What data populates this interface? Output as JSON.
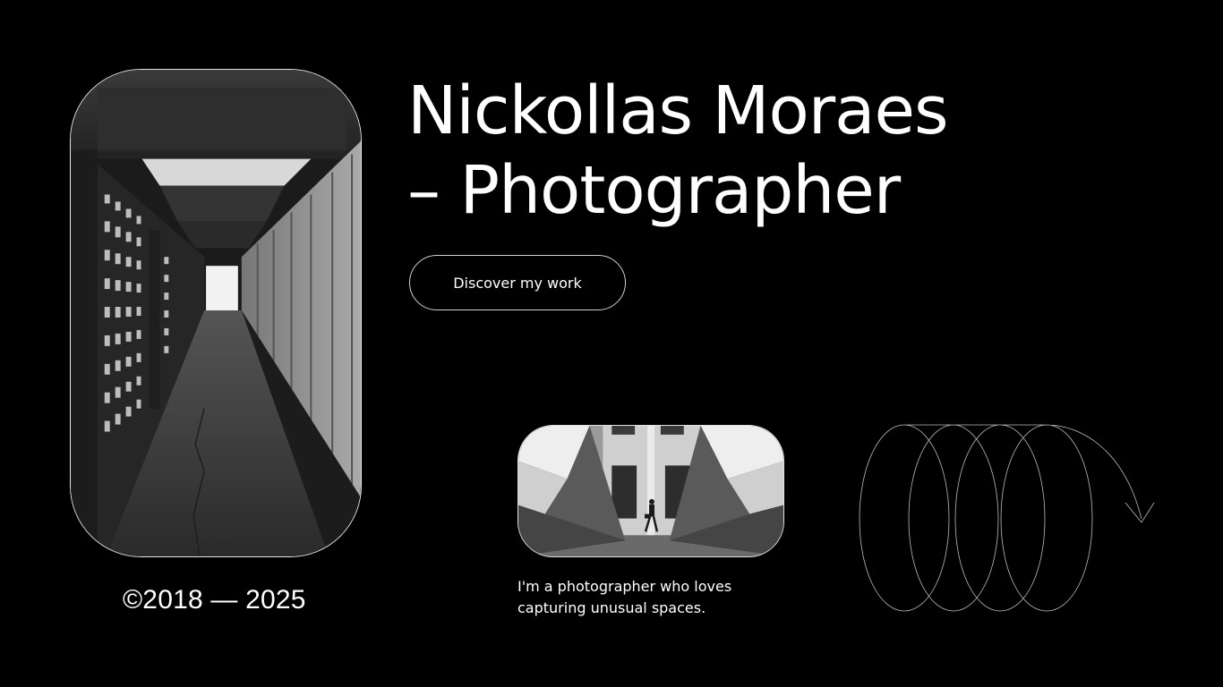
{
  "hero": {
    "title_line1": "Nickollas Moraes",
    "title_line2": "– Photographer",
    "cta_label": "Discover my work"
  },
  "footer": {
    "copyright": "©2018 — 2025"
  },
  "about": {
    "bio": "I'm a photographer who loves capturing unusual spaces."
  },
  "colors": {
    "background": "#000000",
    "text": "#ffffff",
    "border": "#e6e6e6"
  },
  "icons": {
    "spiral": "spiral-arrow-icon"
  }
}
